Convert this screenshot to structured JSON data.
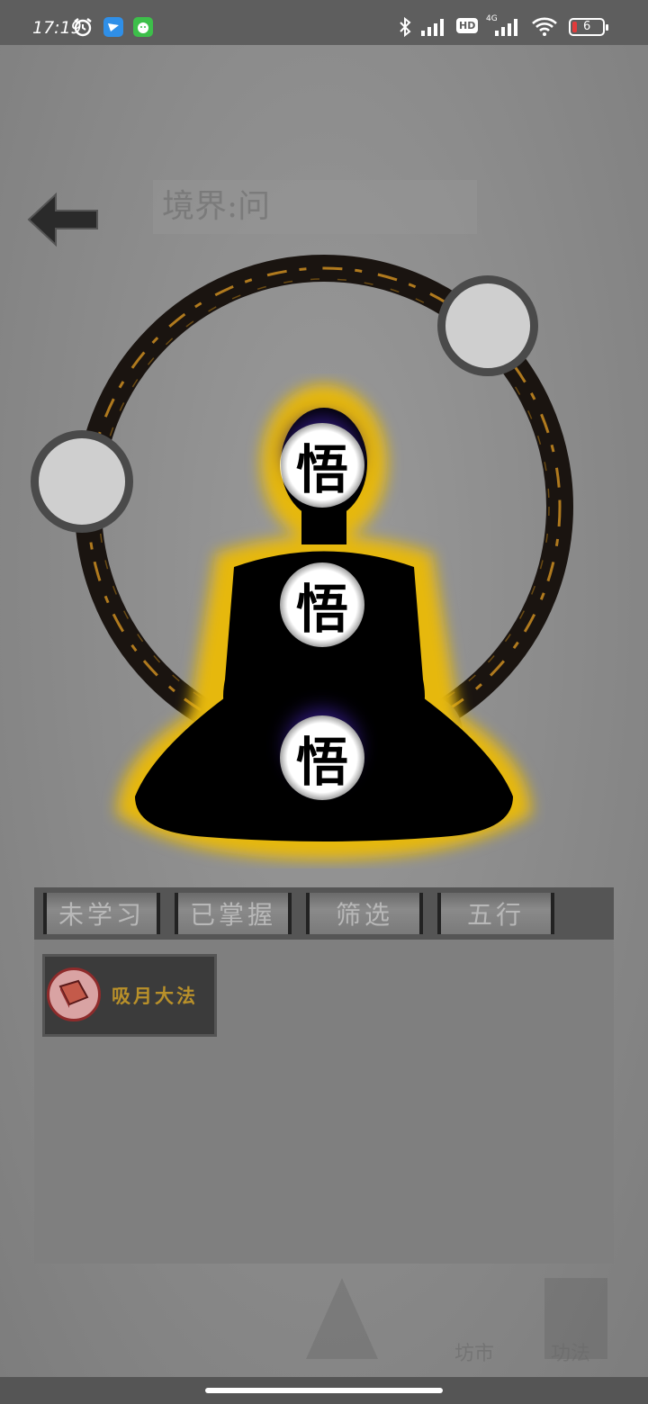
{
  "status_bar": {
    "time": "17:19",
    "battery": "6",
    "network": "4G",
    "hd": "HD"
  },
  "background": {
    "realm_label": "境界:问"
  },
  "meditation": {
    "chakra_glyphs": [
      "悟",
      "悟",
      "悟"
    ]
  },
  "tabs": [
    {
      "label": "未学习"
    },
    {
      "label": "已掌握"
    },
    {
      "label": "筛选"
    },
    {
      "label": "五行"
    }
  ],
  "skills": [
    {
      "name": "吸月大法",
      "icon": "book-icon"
    }
  ],
  "bottom_nav": {
    "items": [
      "坊市",
      "功法"
    ]
  },
  "colors": {
    "aura": "#e6b80e",
    "ring_gold": "#b07a1e",
    "skill_name": "#b8902a",
    "skill_icon_ring": "#8e2b2b"
  }
}
